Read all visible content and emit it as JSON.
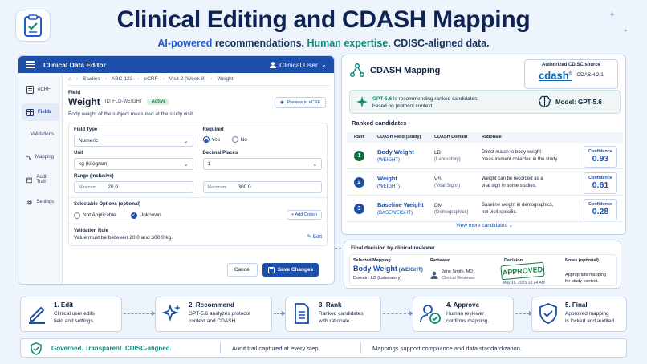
{
  "header": {
    "title": "Clinical Editing and CDASH Mapping",
    "subtitle_1": "AI-powered",
    "subtitle_2": " recommendations. ",
    "subtitle_3": "Human expertise.",
    "subtitle_4": " CDISC-aligned data."
  },
  "editor": {
    "app_title": "Clinical Data Editor",
    "user": "Clinical User",
    "sidebar": [
      {
        "label": "eCRF",
        "icon": "document-icon"
      },
      {
        "label": "Fields",
        "icon": "table-icon",
        "active": true
      },
      {
        "label": "Validations",
        "icon": "shield-check-icon"
      },
      {
        "label": "Mapping",
        "icon": "mapping-icon"
      },
      {
        "label": "Audit Trail",
        "icon": "calendar-icon"
      },
      {
        "label": "Settings",
        "icon": "gear-icon"
      }
    ],
    "breadcrumb": [
      "Studies",
      "ABC-123",
      "eCRF",
      "Visit 2 (Week 8)",
      "Weight"
    ],
    "field_label": "Field",
    "field_name": "Weight",
    "field_id": "ID: FLD-WEIGHT",
    "status": "Active",
    "preview_label": "Preview in eCRF",
    "description": "Body weight of the subject measured at the study visit.",
    "field_type_label": "Field Type",
    "field_type_value": "Numeric",
    "required_label": "Required",
    "required_yes": "Yes",
    "required_no": "No",
    "unit_label": "Unit",
    "unit_value": "kg (kilogram)",
    "decimal_label": "Decimal Places",
    "decimal_value": "1",
    "range_label": "Range (inclusive)",
    "min_label": "Minimum",
    "min_value": "20.0",
    "max_label": "Maximum",
    "max_value": "300.0",
    "options_label": "Selectable Options (optional)",
    "option_1": "Not Applicable",
    "option_2": "Unknown",
    "add_option": "+ Add Option",
    "validation_label": "Validation Rule",
    "validation_text": "Value must be between 20.0 and 300.0 kg.",
    "edit_label": "Edit",
    "cancel_label": "Cancel",
    "save_label": "Save Changes"
  },
  "cdash": {
    "title": "CDASH Mapping",
    "auth_title": "Authorized CDISC source",
    "auth_logo": "cdash",
    "auth_version": "CDASH 2.1",
    "gpt_name": "GPT-5.6",
    "gpt_text_1": " is recommending ranked candidates",
    "gpt_text_2": "based on protocol context.",
    "model_label": "Model: GPT-5.6",
    "ranked_title": "Ranked candidates",
    "columns": {
      "rank": "Rank",
      "field": "CDASH Field (Study)",
      "domain": "CDASH Domain",
      "rationale": "Rationale"
    },
    "confidence_label": "Confidence",
    "candidates": [
      {
        "rank": "1",
        "field": "Body Weight",
        "code": "(WEIGHT)",
        "domain": "LB",
        "domain_full": "(Laboratory)",
        "rationale_1": "Direct match to body weight",
        "rationale_2": "measurement collected in the study.",
        "confidence": "0.93"
      },
      {
        "rank": "2",
        "field": "Weight",
        "code": "(WEIGHT)",
        "domain": "VS",
        "domain_full": "(Vital Signs)",
        "rationale_1": "Weight can be recorded as a",
        "rationale_2": "vital sign in some studies.",
        "confidence": "0.61"
      },
      {
        "rank": "3",
        "field": "Baseline Weight",
        "code": "(BASEWEIGHT)",
        "domain": "DM",
        "domain_full": "(Demographics)",
        "rationale_1": "Baseline weight in demographics,",
        "rationale_2": "not visit-specific.",
        "confidence": "0.28"
      }
    ],
    "view_more": "View more candidates"
  },
  "final": {
    "title": "Final decision by clinical reviewer",
    "selected_label": "Selected Mapping",
    "selected_field": "Body Weight",
    "selected_code": " (WEIGHT)",
    "selected_domain": "Domain: LB (Laboratory)",
    "reviewer_label": "Reviewer",
    "reviewer_name": "Jane Smith, MD",
    "reviewer_role": "Clinical Reviewer",
    "decision_label": "Decision",
    "decision": "APPROVED",
    "decision_date": "May 16, 2025 10:24 AM",
    "notes_label": "Notes (optional)",
    "notes_1": "Appropriate mapping",
    "notes_2": "for study context."
  },
  "steps": [
    {
      "title": "1. Edit",
      "line1": "Clinical user edits",
      "line2": "field and settings.",
      "icon": "pencil-icon"
    },
    {
      "title": "2. Recommend",
      "line1": "GPT-5.6 analyzes protocol",
      "line2": "context and CDASH.",
      "icon": "sparkle-icon"
    },
    {
      "title": "3. Rank",
      "line1": "Ranked candidates",
      "line2": "with rationale.",
      "icon": "ranked-list-icon"
    },
    {
      "title": "4. Approve",
      "line1": "Human reviewer",
      "line2": "confirms mapping.",
      "icon": "reviewer-icon"
    },
    {
      "title": "5. Final",
      "line1": "Approved mapping",
      "line2": "is locked and audited.",
      "icon": "shield-check-icon"
    }
  ],
  "footer": {
    "tagline": "Governed. Transparent. CDISC-aligned.",
    "audit": "Audit trail captured at every step.",
    "compliance": "Mappings support compliance and data standardization."
  },
  "colors": {
    "primary": "#1c4faa",
    "teal": "#0d8a7a",
    "approved": "#1b7a46",
    "title": "#0e2353"
  }
}
